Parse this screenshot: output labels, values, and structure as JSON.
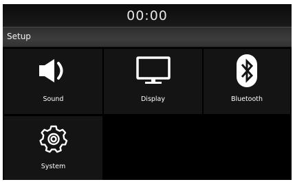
{
  "status_bar": {
    "time": "00:00"
  },
  "header": {
    "title": "Setup"
  },
  "menu": {
    "items": [
      {
        "label": "Sound",
        "icon": "speaker-icon"
      },
      {
        "label": "Display",
        "icon": "monitor-icon"
      },
      {
        "label": "Bluetooth",
        "icon": "bluetooth-icon"
      },
      {
        "label": "System",
        "icon": "gear-icon"
      }
    ]
  }
}
